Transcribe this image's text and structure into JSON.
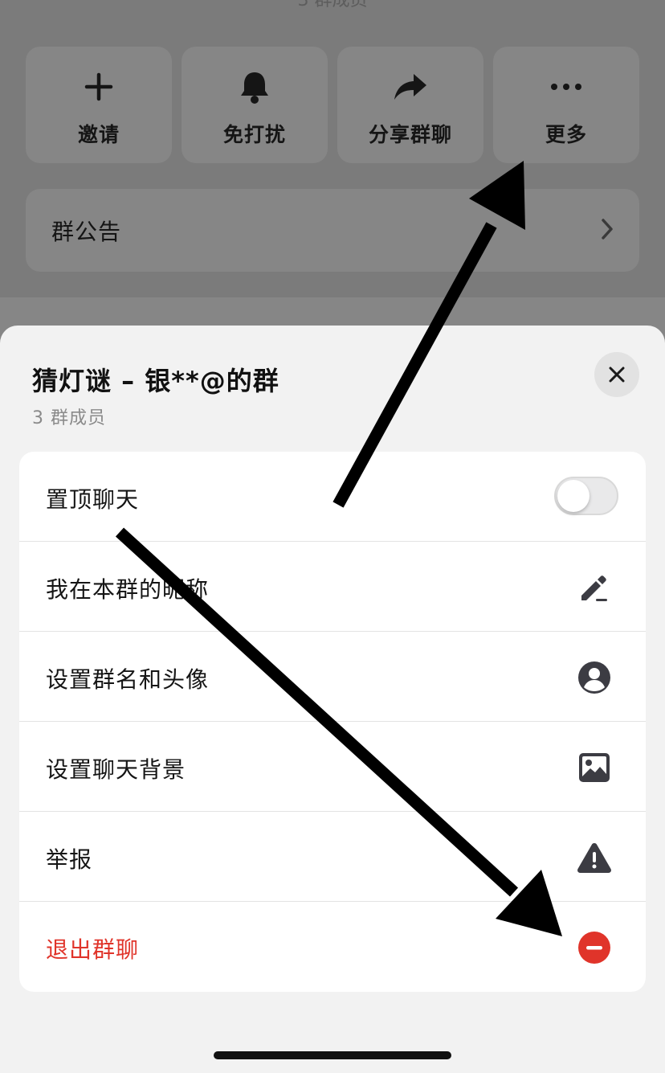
{
  "background": {
    "subtitle_partial": "3 群成员",
    "actions": [
      {
        "label": "邀请",
        "icon": "plus-icon"
      },
      {
        "label": "免打扰",
        "icon": "bell-icon"
      },
      {
        "label": "分享群聊",
        "icon": "share-icon"
      },
      {
        "label": "更多",
        "icon": "more-icon"
      }
    ],
    "announcement_label": "群公告"
  },
  "sheet": {
    "title": "猜灯谜 – 银**@的群",
    "subtitle": "3 群成员",
    "items": [
      {
        "label": "置顶聊天",
        "control": "toggle",
        "toggle_on": false
      },
      {
        "label": "我在本群的昵称",
        "icon": "edit-pencil-icon"
      },
      {
        "label": "设置群名和头像",
        "icon": "profile-icon"
      },
      {
        "label": "设置聊天背景",
        "icon": "image-icon"
      },
      {
        "label": "举报",
        "icon": "warning-icon"
      },
      {
        "label": "退出群聊",
        "icon": "leave-icon",
        "color": "#e0342a"
      }
    ]
  },
  "colors": {
    "danger": "#e0342a",
    "icon_gray": "#3c3c43"
  }
}
